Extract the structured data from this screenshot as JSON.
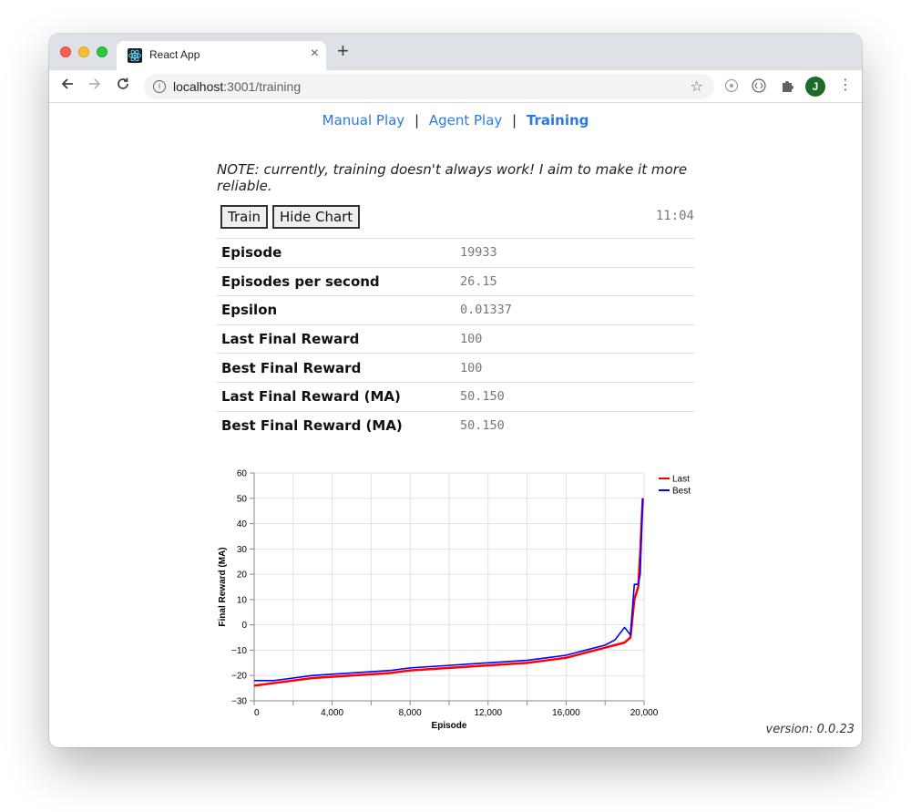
{
  "browser": {
    "tab_title": "React App",
    "url_host": "localhost",
    "url_path": ":3001/training",
    "close_glyph": "×",
    "new_tab_glyph": "+",
    "avatar_letter": "J"
  },
  "nav": {
    "manual": "Manual Play",
    "agent": "Agent Play",
    "training": "Training",
    "sep": "|"
  },
  "note": "NOTE: currently, training doesn't always work! I aim to make it more reliable.",
  "controls": {
    "train_label": "Train",
    "chart_label": "Hide Chart",
    "clock": "11:04"
  },
  "stats": [
    {
      "label": "Episode",
      "value": "19933"
    },
    {
      "label": "Episodes per second",
      "value": "26.15"
    },
    {
      "label": "Epsilon",
      "value": "0.01337"
    },
    {
      "label": "Last Final Reward",
      "value": "100"
    },
    {
      "label": "Best Final Reward",
      "value": "100"
    },
    {
      "label": "Last Final Reward (MA)",
      "value": "50.150"
    },
    {
      "label": "Best Final Reward (MA)",
      "value": "50.150"
    }
  ],
  "version": "version: 0.0.23",
  "chart_data": {
    "type": "line",
    "xlabel": "Episode",
    "ylabel": "Final Reward (MA)",
    "xlim": [
      0,
      20000
    ],
    "ylim": [
      -30,
      60
    ],
    "x_ticks": [
      0,
      4000,
      8000,
      12000,
      16000,
      20000
    ],
    "x_tick_labels": [
      "0",
      "4,000",
      "8,000",
      "12,000",
      "16,000",
      "20,000"
    ],
    "y_ticks": [
      -30,
      -20,
      -10,
      0,
      10,
      20,
      30,
      40,
      50,
      60
    ],
    "grid": true,
    "legend_position": "top-right",
    "series": [
      {
        "name": "Last",
        "color": "#ff0000",
        "x": [
          0,
          1000,
          2000,
          3000,
          4000,
          5000,
          6000,
          7000,
          8000,
          9000,
          10000,
          11000,
          12000,
          13000,
          14000,
          15000,
          16000,
          17000,
          18000,
          18500,
          19000,
          19300,
          19500,
          19700,
          19800,
          19933
        ],
        "y": [
          -24,
          -23,
          -22,
          -21,
          -20.5,
          -20,
          -19.5,
          -19,
          -18,
          -17.5,
          -17,
          -16.5,
          -16,
          -15.5,
          -15,
          -14,
          -13,
          -11,
          -9,
          -8,
          -7,
          -5,
          10,
          15,
          28,
          50
        ]
      },
      {
        "name": "Best",
        "color": "#0000ff",
        "x": [
          0,
          1000,
          2000,
          3000,
          4000,
          5000,
          6000,
          7000,
          8000,
          9000,
          10000,
          11000,
          12000,
          13000,
          14000,
          15000,
          16000,
          17000,
          18000,
          18500,
          19000,
          19300,
          19500,
          19700,
          19800,
          19933
        ],
        "y": [
          -22,
          -22,
          -21,
          -20,
          -19.5,
          -19,
          -18.5,
          -18,
          -17,
          -16.5,
          -16,
          -15.5,
          -15,
          -14.5,
          -14,
          -13,
          -12,
          -10,
          -8,
          -6,
          -1,
          -4,
          16,
          16,
          20,
          50
        ]
      }
    ]
  }
}
